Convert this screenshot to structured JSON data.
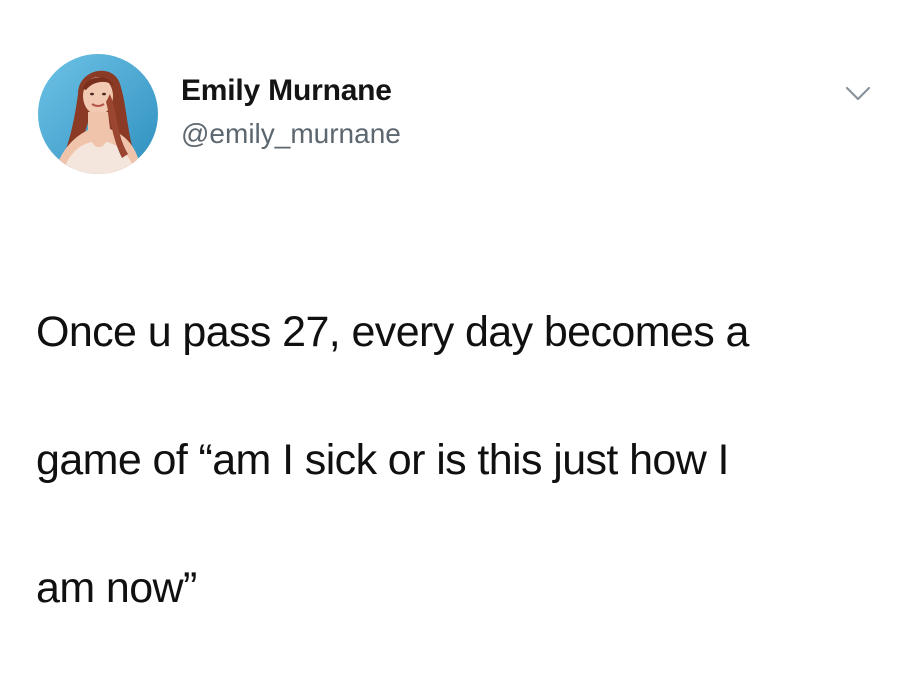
{
  "tweet": {
    "author_name": "Emily Murnane",
    "author_handle": "@emily_murnane",
    "text_lines": [
      "Once u pass 27, every day becomes a",
      "game of “am I sick or is this just how I",
      "am now”"
    ],
    "avatar_icon": "profile-photo",
    "menu_icon": "chevron-down-icon"
  },
  "colors": {
    "name": "#141414",
    "handle": "#5c6770",
    "text": "#101010",
    "avatar_bg": "#4aa9cf",
    "chevron": "#8a939b"
  }
}
